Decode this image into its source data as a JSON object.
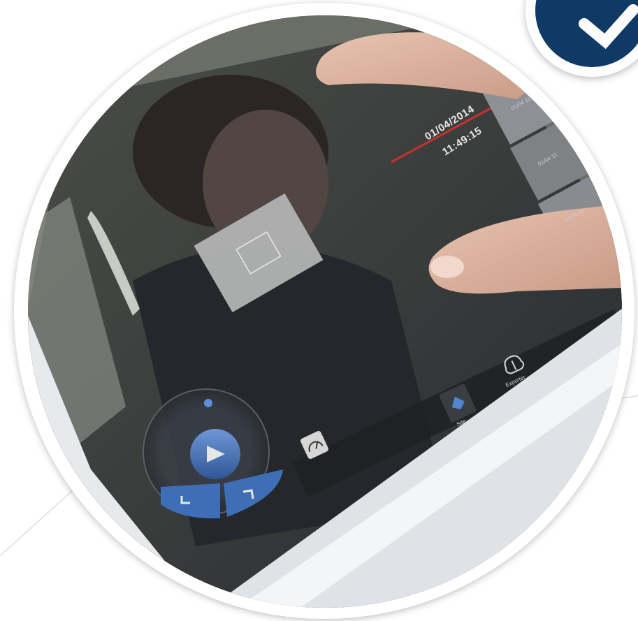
{
  "screen": {
    "date": "01/04/2014",
    "time": "11:49:15",
    "thumbnail_labels": [
      "01/04 11:4",
      "01/04 11:",
      "01/04 11:"
    ]
  },
  "toolbar": {
    "site_label": "Site",
    "export_label": "Exporter"
  },
  "colors": {
    "badge": "#0f3a66",
    "accent": "#3e6fb6",
    "timeline_marker": "#c8322e"
  }
}
